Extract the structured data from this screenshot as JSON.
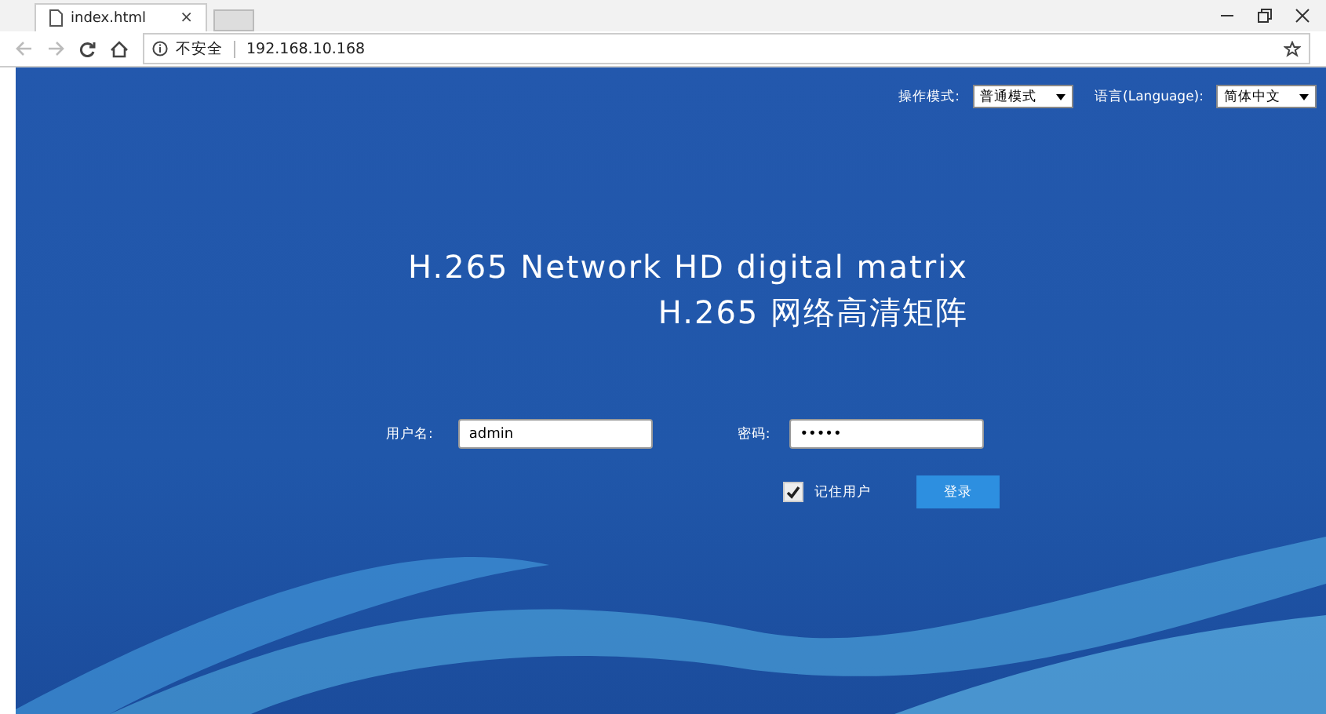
{
  "browser": {
    "tab_title": "index.html",
    "tab_close": "×",
    "security_label": "不安全",
    "url": "192.168.10.168"
  },
  "top_bar": {
    "mode_label": "操作模式:",
    "mode_value": "普通模式",
    "language_label": "语言(Language):",
    "language_value": "简体中文"
  },
  "title": {
    "line_1": "H.265 Network HD digital matrix",
    "line_2": "H.265 网络高清矩阵"
  },
  "login": {
    "username_label": "用户名:",
    "username_value": "admin",
    "password_label": "密码:",
    "password_value": "•••••",
    "remember_label": "记住用户",
    "remember_checked": true,
    "login_button": "登录"
  }
}
